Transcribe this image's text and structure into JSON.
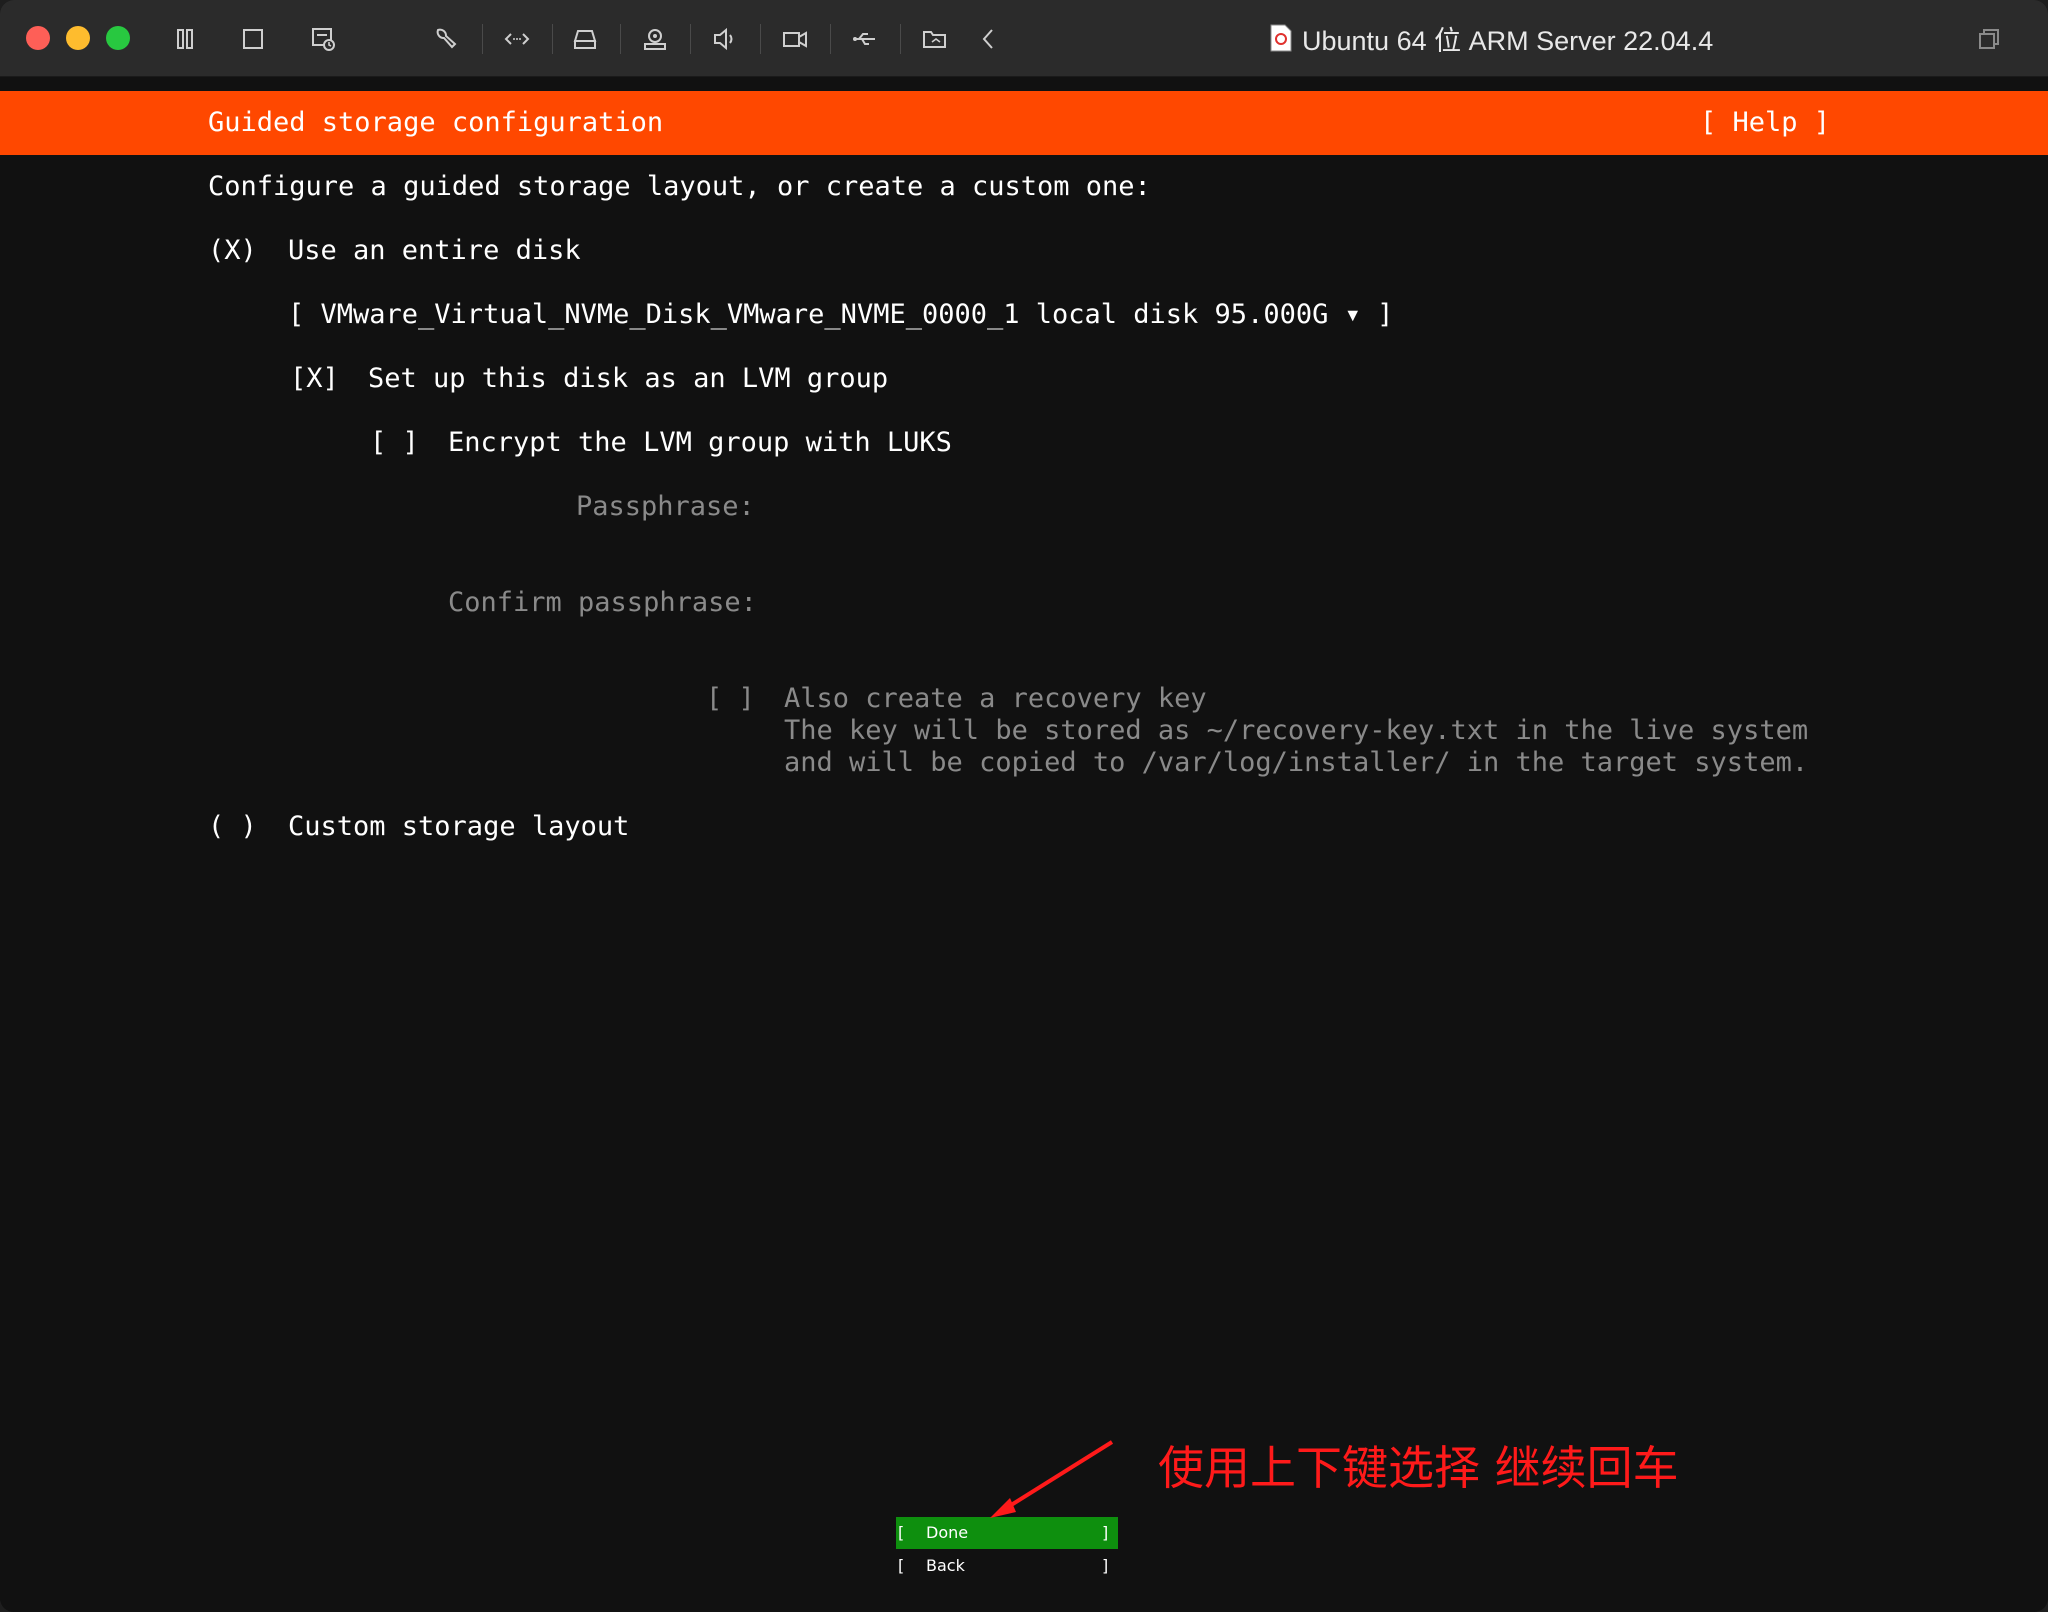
{
  "window": {
    "title": "Ubuntu 64 位 ARM Server 22.04.4",
    "traffic_lights": {
      "close": "#fe5f57",
      "minimize": "#febc2e",
      "zoom": "#28c840"
    },
    "toolbar_icons": [
      "pause-icon",
      "stop-icon",
      "snapshot-icon",
      "wrench-icon",
      "network-arrows-icon",
      "hard-disk-icon",
      "camera-user-icon",
      "sound-icon",
      "video-camera-icon",
      "usb-icon",
      "shared-folder-icon",
      "chevron-left-icon",
      "restore-window-icon"
    ]
  },
  "installer": {
    "header_title": "Guided storage configuration",
    "help_label": "[ Help ]",
    "header_color": "#ff4800",
    "intro": "Configure a guided storage layout, or create a custom one:",
    "use_entire_disk": {
      "marker": "(X)",
      "label": "Use an entire disk"
    },
    "disk_select": {
      "value": "[ VMware_Virtual_NVMe_Disk_VMware_NVME_0000_1 local disk 95.000G ▾ ]"
    },
    "lvm_group": {
      "marker": "[X]",
      "label": "Set up this disk as an LVM group"
    },
    "encrypt": {
      "marker": "[ ]",
      "label": "Encrypt the LVM group with LUKS"
    },
    "passphrase_label": "Passphrase:",
    "confirm_passphrase_label": "Confirm passphrase:",
    "recovery_key": {
      "marker": "[ ]",
      "label": "Also create a recovery key",
      "desc_line1": "The key will be stored as ~/recovery-key.txt in the live system",
      "desc_line2": "and will be copied to /var/log/installer/ in the target system."
    },
    "custom_layout": {
      "marker": "( )",
      "label": "Custom storage layout"
    },
    "done_button": {
      "open": "[",
      "label": "Done",
      "close": "]",
      "color": "#0e8f0e"
    },
    "back_button": {
      "open": "[",
      "label": "Back",
      "close": "]"
    }
  },
  "annotation": {
    "text": "使用上下键选择 继续回车",
    "color": "#ff1a1a"
  }
}
